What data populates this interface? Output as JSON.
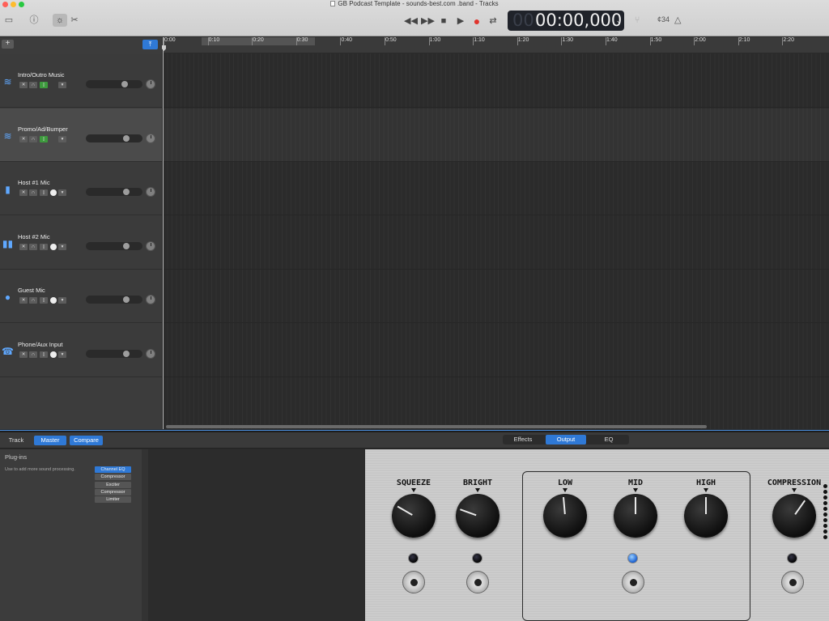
{
  "window": {
    "title": "GB Podcast Template - sounds-best.com .band - Tracks",
    "traffic_colors": [
      "#ff5f57",
      "#febc2e",
      "#28c840"
    ]
  },
  "toolbar": {
    "library_icon": "inbox-icon",
    "help_icon": "help-icon",
    "smart_controls_icon": "smart-controls-icon",
    "editors_icon": "scissors-icon",
    "rewind_icon": "rewind-icon",
    "forward_icon": "fast-forward-icon",
    "stop_icon": "stop-icon",
    "play_icon": "play-icon",
    "record_icon": "record-icon",
    "cycle_icon": "cycle-icon",
    "lcd_ghost": "00",
    "lcd_time": "00:00,000",
    "tuner_icon": "tuning-fork-icon",
    "count_in": "¢34",
    "metronome_icon": "metronome-icon"
  },
  "ruler": {
    "ticks": [
      "0:00",
      "0:10",
      "0:20",
      "0:30",
      "0:40",
      "0:50",
      "1:00",
      "1:10",
      "1:20",
      "1:30",
      "1:40",
      "1:50",
      "2:00",
      "2:10",
      "2:20"
    ]
  },
  "tracks": [
    {
      "name": "Intro/Outro Music",
      "icon": "waveform-icon",
      "lock_green": true,
      "volume": 0.71,
      "selected": false
    },
    {
      "name": "Promo/Ad/Bumper",
      "icon": "waveform-icon",
      "lock_green": true,
      "volume": 0.74,
      "selected": true
    },
    {
      "name": "Host #1 Mic",
      "icon": "microphone-icon",
      "lock_green": false,
      "volume": 0.74,
      "selected": false
    },
    {
      "name": "Host #2 Mic",
      "icon": "microphones-icon",
      "lock_green": false,
      "volume": 0.74,
      "selected": false
    },
    {
      "name": "Guest Mic",
      "icon": "person-icon",
      "lock_green": false,
      "volume": 0.74,
      "selected": false
    },
    {
      "name": "Phone/Aux Input",
      "icon": "telephone-icon",
      "lock_green": false,
      "volume": 0.74,
      "selected": false
    }
  ],
  "smart_controls": {
    "tabs": {
      "track": "Track",
      "master": "Master",
      "compare": "Compare"
    },
    "view_tabs": {
      "effects": "Effects",
      "output": "Output",
      "eq": "EQ"
    },
    "plugins": {
      "title": "Plug-ins",
      "hint": "Use to add more sound processing.",
      "slots": [
        "Channel EQ",
        "Compressor",
        "Exciter",
        "Compressor",
        "Limiter"
      ]
    },
    "knobs": {
      "squeeze": {
        "label": "SQUEEZE",
        "angle": -60
      },
      "bright": {
        "label": "BRIGHT",
        "angle": -70
      },
      "low": {
        "label": "LOW",
        "angle": -5
      },
      "mid": {
        "label": "MID",
        "angle": 0
      },
      "high": {
        "label": "HIGH",
        "angle": 0
      },
      "compression": {
        "label": "COMPRESSION",
        "angle": 35
      }
    }
  },
  "colors": {
    "accent": "#2f79d6",
    "record": "#e0342d",
    "enabled_green": "#3d9a3d"
  }
}
